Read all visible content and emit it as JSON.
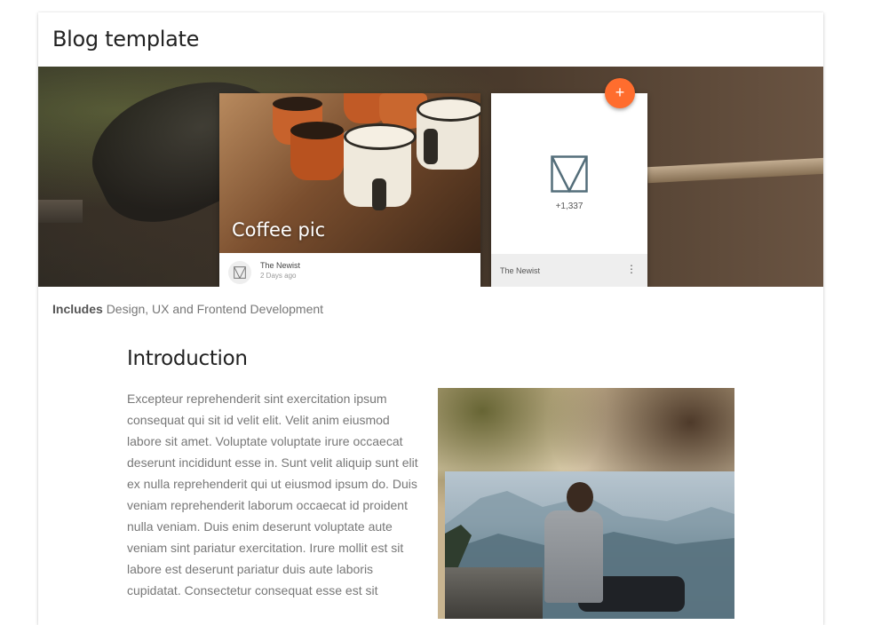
{
  "card": {
    "title": "Blog template"
  },
  "hero": {
    "photo_card": {
      "caption": "Coffee pic",
      "author": "The Newist",
      "date": "2 Days ago"
    },
    "stat_card": {
      "count": "+1,337",
      "name": "The Newist",
      "more_icon": "⋮"
    },
    "fab_label": "+"
  },
  "includes": {
    "label": "Includes",
    "value": "Design, UX and Frontend Development"
  },
  "article": {
    "heading": "Introduction",
    "body": "Excepteur reprehenderit sint exercitation ipsum consequat qui sit id velit elit. Velit anim eiusmod labore sit amet. Voluptate voluptate irure occaecat deserunt incididunt esse in. Sunt velit aliquip sunt elit ex nulla reprehenderit qui ut eiusmod ipsum do. Duis veniam reprehenderit laborum occaecat id proident nulla veniam. Duis enim deserunt voluptate aute veniam sint pariatur exercitation. Irure mollit est sit labore est deserunt pariatur duis aute laboris cupidatat. Consectetur consequat esse est sit"
  },
  "colors": {
    "fab": "#ff6d2e",
    "logo_stroke": "#546e7a"
  }
}
